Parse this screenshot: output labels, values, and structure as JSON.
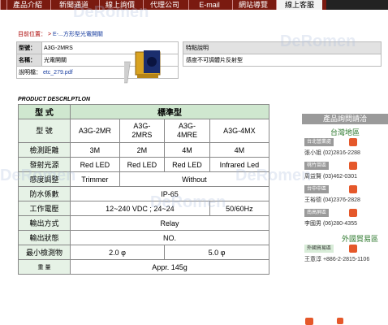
{
  "nav": [
    "產品介紹",
    "新聞通道",
    "線上詢價",
    "代理公司",
    "E-mail",
    "網站導覽",
    "線上客服"
  ],
  "breadcrumb": {
    "prefix": "目前位置：",
    "sep": ">",
    "current": "E-...方形型光電開關"
  },
  "product": {
    "model_label": "型號：",
    "model": "A3G-2MRS",
    "name_label": "名稱：",
    "name": "光電開關",
    "manual_label": "說明檔：",
    "manual": "etc_279.pdf"
  },
  "features": {
    "heading": "特點說明",
    "text": "感度不可調體片反射型"
  },
  "spec_title": "PRODUCT DESCRLPTLON",
  "spec": {
    "header": [
      "型  式",
      "標準型"
    ],
    "model_label": "型   號",
    "models": [
      "A3G-2MR",
      "A3G-\n2MRS",
      "A3G-\n4MRE",
      "A3G-4MX"
    ],
    "distance_label": "檢測距離",
    "distances": [
      "3M",
      "2M",
      "4M",
      "4M"
    ],
    "light_label": "發射光源",
    "lights": [
      "Red LED",
      "Red LED",
      "Red LED",
      "Infrared Led"
    ],
    "sens_label": "感度調整",
    "sens": [
      "Trimmer",
      "Without"
    ],
    "ip_label": "防水係數",
    "ip": "IP-65",
    "volt_label": "工作電壓",
    "volt": "12~240 VDC ; 24~24",
    "freq": "50/60Hz",
    "output_label": "輸出方式",
    "output": "Relay",
    "state_label": "輸出狀態",
    "state": "NO.",
    "min_label": "最小檢測物",
    "min": [
      "2.0 φ",
      "5.0 φ"
    ],
    "weight_label": "重    量",
    "weight": "Appr. 145g"
  },
  "sidebar": {
    "title": "產品詢問請洽",
    "region_tw": "台灣地區",
    "contacts": [
      {
        "area": "台北營業處",
        "line": "張小姐 (02)2816-2288"
      },
      {
        "area": "桃竹苗區",
        "line": "周益賢 (03)462-0301"
      },
      {
        "area": "台中中區",
        "line": "王裕德 (04)2376-2828"
      },
      {
        "area": "南高屏區",
        "line": "李國男 (06)280-4355"
      }
    ],
    "region_foreign": "外國貿易區",
    "foreign": [
      {
        "area": "外國貿易區",
        "line": "王意淳 +886-2-2815-1106"
      }
    ]
  },
  "watermark": "DeRomen"
}
